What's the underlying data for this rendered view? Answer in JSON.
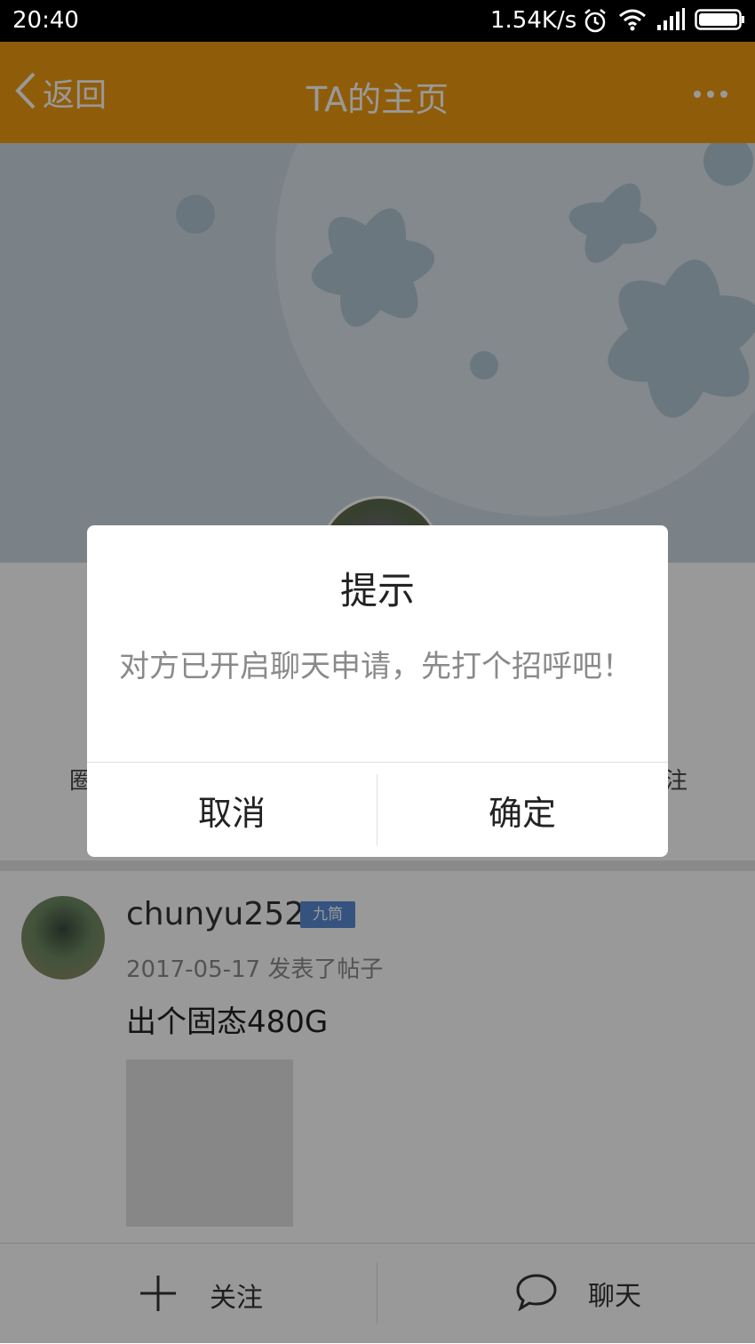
{
  "status_bar": {
    "time": "20:40",
    "network_speed": "1.54K/s",
    "icons": [
      "alarm-icon",
      "wifi-icon",
      "signal-icon",
      "battery-icon"
    ]
  },
  "top_bar": {
    "back_label": "返回",
    "title": "TA的主页",
    "more_icon": "more-icon"
  },
  "profile": {
    "stats_left_partial": "圈",
    "stats_right_partial": "注"
  },
  "post": {
    "username": "chunyu252",
    "badge": "九筒",
    "meta": "2017-05-17  发表了帖子",
    "content": "出个固态480G"
  },
  "bottom_bar": {
    "follow_label": "关注",
    "chat_label": "聊天"
  },
  "dialog": {
    "title": "提示",
    "message": "对方已开启聊天申请，先打个招呼吧！",
    "cancel_label": "取消",
    "confirm_label": "确定"
  },
  "colors": {
    "accent": "#ef9b12",
    "badge": "#5b8bd6",
    "overlay": "rgba(0,0,0,0.40)"
  }
}
